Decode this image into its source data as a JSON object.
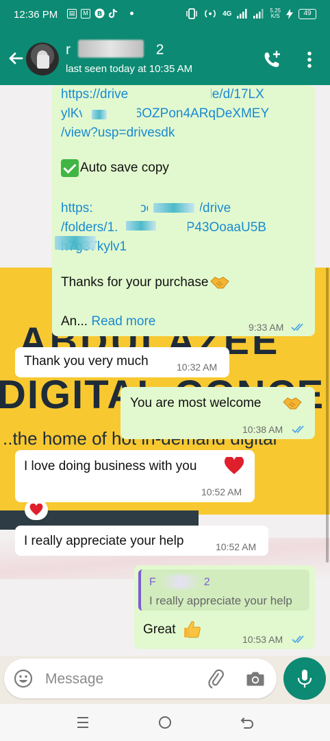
{
  "status_bar": {
    "time": "12:36 PM",
    "network": "4G",
    "speed_value": "5.25",
    "speed_unit": "K/S",
    "battery": "49"
  },
  "header": {
    "contact_name_start": "r",
    "contact_name_end": "2",
    "last_seen": "last seen today at 10:35 AM"
  },
  "wallpaper": {
    "line1": "ABDULAZEE",
    "line2": "DIGITAL CONCE",
    "line3": "..the home of hot in-demand digital"
  },
  "messages": [
    {
      "direction": "out",
      "link1_line1": "https://drive.google.com/file/d/17LX",
      "link1_line2": "ylKvp...1yOu6OZPon4ARqDeXMEY",
      "link1_line3": "/view?usp=drivesdk",
      "auto_save": "Auto save copy",
      "link2_line1": "https://drive.google.com/drive",
      "link2_line2": "/folders/1...xiDK6Stx7P43OoaaU5B",
      "link2_line3": "h7g37kylv1",
      "thanks": "Thanks for your purchase",
      "truncated": "An...",
      "read_more": "Read more",
      "time": "9:33 AM"
    },
    {
      "direction": "in",
      "text": "Thank you very much",
      "time": "10:32 AM"
    },
    {
      "direction": "out",
      "text": "You are most welcome",
      "time": "10:38 AM"
    },
    {
      "direction": "in",
      "text": "I love doing business with you",
      "time": "10:52 AM",
      "reaction": "heart"
    },
    {
      "direction": "in",
      "text": "I really appreciate your help",
      "time": "10:52 AM"
    },
    {
      "direction": "out",
      "quote_name": "F",
      "quote_name_end": "2",
      "quote_text": "I really appreciate your help",
      "text": "Great",
      "time": "10:53 AM"
    }
  ],
  "composer": {
    "placeholder": "Message"
  },
  "colors": {
    "header": "#0c8a73",
    "outgoing_bubble": "#e2f9cf",
    "incoming_bubble": "#ffffff",
    "link": "#1a8ad1",
    "read_ticks": "#4fa6e6",
    "wallpaper_yellow": "#f7c830"
  },
  "icons": {
    "back": "arrow-left-icon",
    "call": "add-call-icon",
    "menu": "more-vert-icon",
    "emoji": "emoji-icon",
    "attach": "paperclip-icon",
    "camera": "camera-icon",
    "mic": "mic-icon",
    "handshake": "handshake-emoji",
    "heart": "heart-emoji",
    "thumbs_up": "thumbs-up-emoji",
    "check": "check-mark-button-emoji"
  }
}
